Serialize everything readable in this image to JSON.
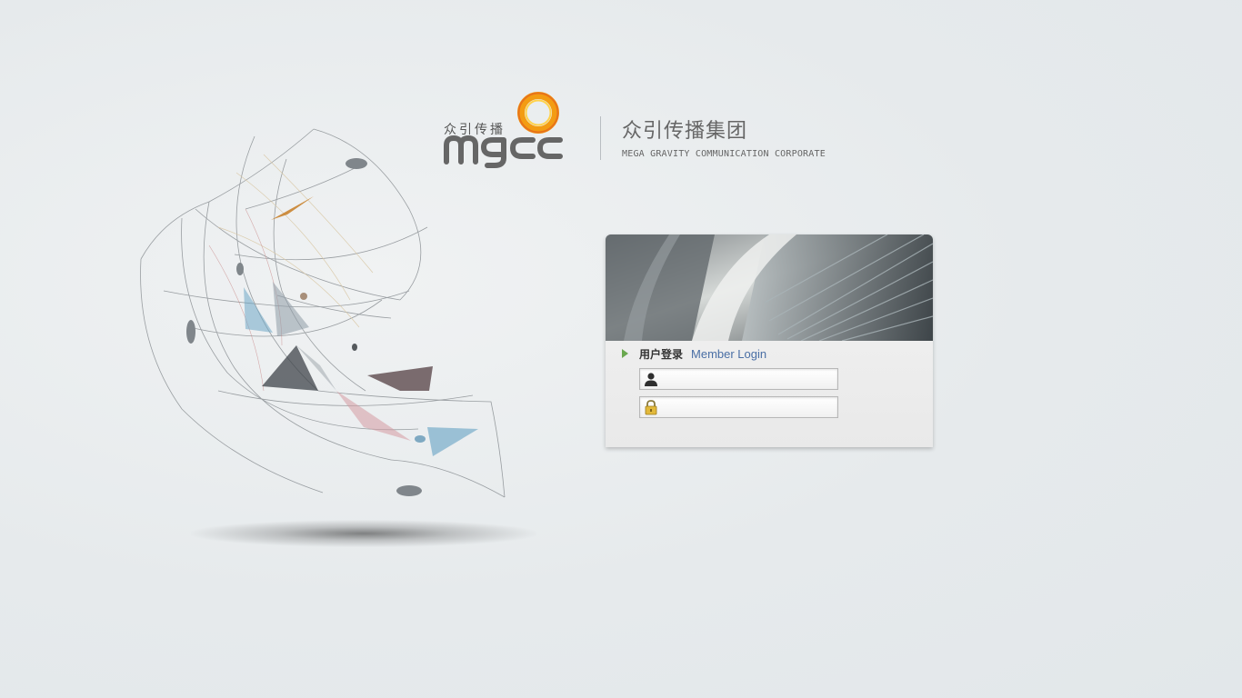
{
  "brand": {
    "logo_cn": "众引传播",
    "logo_word": "mgcc",
    "title_cn": "众引传播集团",
    "subtitle_en": "MEGA GRAVITY COMMUNICATION CORPORATE"
  },
  "login": {
    "heading_cn": "用户登录",
    "heading_en": "Member Login",
    "username": {
      "value": "",
      "placeholder": "",
      "icon": "user-icon"
    },
    "password": {
      "value": "",
      "placeholder": "",
      "icon": "lock-icon"
    }
  },
  "colors": {
    "accent_orange": "#f39c12",
    "link_blue": "#4a6fa5",
    "arrow_green": "#6aa84f",
    "background": "#e6eaec"
  }
}
